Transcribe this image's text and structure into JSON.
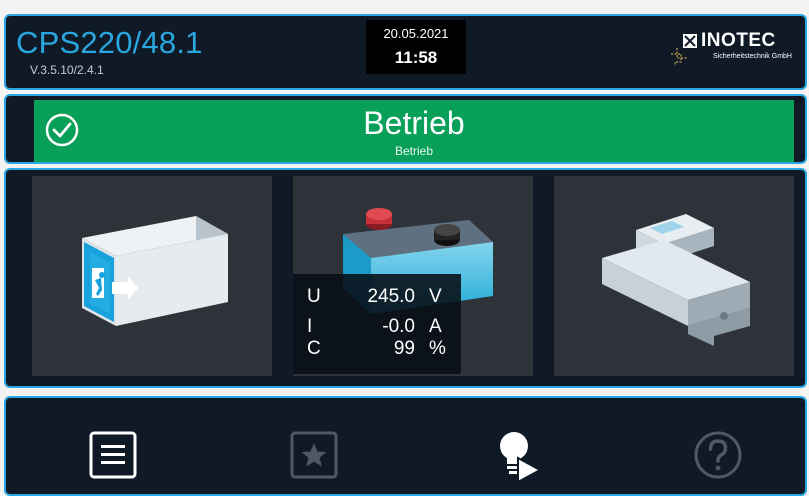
{
  "header": {
    "model": "CPS220/48.1",
    "version": "V.3.5.10/2.4.1",
    "date": "20.05.2021",
    "time": "11:58",
    "logo_brand": "INOTEC",
    "logo_sub": "Sicherheitstechnik GmbH"
  },
  "status": {
    "title": "Betrieb",
    "subtitle": "Betrieb",
    "color": "#08a058",
    "icon": "check-circle-icon"
  },
  "components": {
    "luminaires": {
      "icon": "exit-sign-icon"
    },
    "battery": {
      "icon": "battery-icon",
      "readout": [
        {
          "symbol": "U",
          "value": "245.0",
          "unit": "V"
        },
        {
          "symbol": "I",
          "value": "-0.0",
          "unit": "A"
        },
        {
          "symbol": "C",
          "value": "99",
          "unit": "%"
        }
      ]
    },
    "module": {
      "icon": "din-rail-module-icon"
    }
  },
  "toolbar": [
    {
      "name": "menu-list-icon",
      "state": "active"
    },
    {
      "name": "favorites-star-icon",
      "state": "disabled"
    },
    {
      "name": "light-test-icon",
      "state": "active"
    },
    {
      "name": "help-icon",
      "state": "disabled"
    }
  ],
  "colors": {
    "accent": "#2aa7e0",
    "panel_bg": "#0f1a26",
    "tile_bg": "#2d3339",
    "status_ok": "#08a058"
  }
}
